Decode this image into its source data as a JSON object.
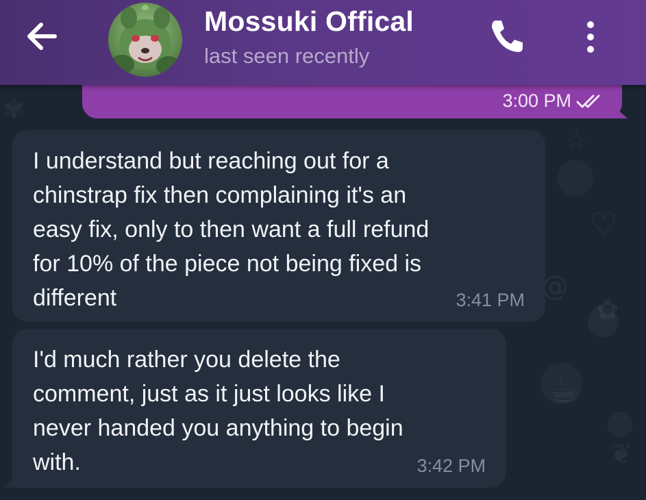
{
  "header": {
    "title": "Mossuki Offical",
    "status": "last seen recently",
    "back_icon": "arrow-left-icon",
    "call_icon": "phone-icon",
    "menu_icon": "more-vertical-icon",
    "color": "#5a3887"
  },
  "messages": {
    "outgoing": {
      "time": "3:00 PM",
      "status_icon": "double-check-icon",
      "color": "#8e3ea8"
    },
    "incoming": [
      {
        "lines": [
          "I understand but reaching out for a",
          "chinstrap fix then complaining it's an",
          "easy fix, only to then want a full refund",
          "for 10% of the piece not being fixed is",
          "different"
        ],
        "time": "3:41 PM"
      },
      {
        "lines": [
          "I'd much rather you delete the",
          "comment, just as it just looks like I",
          "never handed you anything to begin",
          "with."
        ],
        "time": "3:42 PM"
      }
    ]
  }
}
